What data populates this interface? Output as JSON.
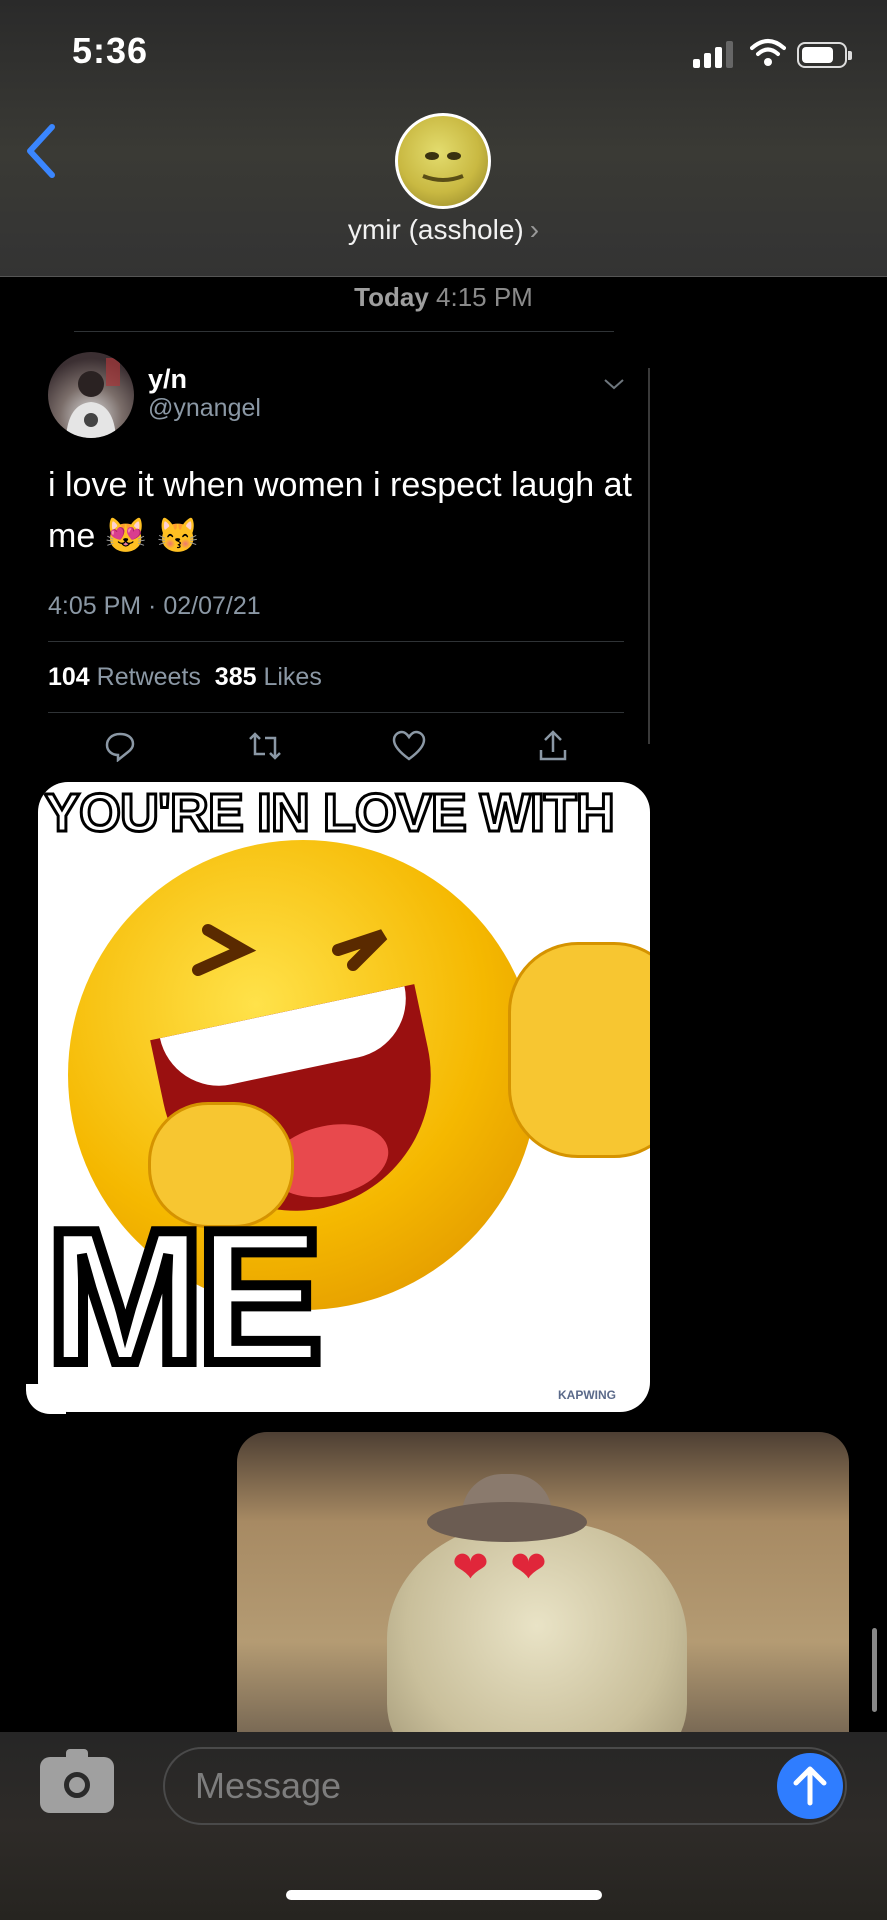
{
  "status_bar": {
    "time": "5:36",
    "battery_level": 0.8,
    "signal_bars": 3
  },
  "header": {
    "contact_name": "ymir (asshole)",
    "chevron": "›",
    "back_icon": "chevron-left-icon"
  },
  "thread": {
    "timestamp_day": "Today",
    "timestamp_time": "4:15 PM"
  },
  "tweet": {
    "display_name": "y/n",
    "handle": "@ynangel",
    "text": "i love it when women i respect laugh at me 😻 😽",
    "date": "4:05 PM · 02/07/21",
    "retweets_count": "104",
    "retweets_label": "Retweets",
    "likes_count": "385",
    "likes_label": "Likes",
    "actions": [
      "reply-icon",
      "retweet-icon",
      "like-icon",
      "share-icon"
    ]
  },
  "meme": {
    "top_text": "YOU'RE IN LOVE WITH",
    "bottom_text": "ME",
    "watermark": "KAPWING"
  },
  "composer": {
    "placeholder": "Message",
    "camera_icon": "camera-icon",
    "send_icon": "send-arrow-icon"
  },
  "colors": {
    "accent": "#2f7dff",
    "back": "#3a86ff",
    "muted": "#8b98a5"
  }
}
